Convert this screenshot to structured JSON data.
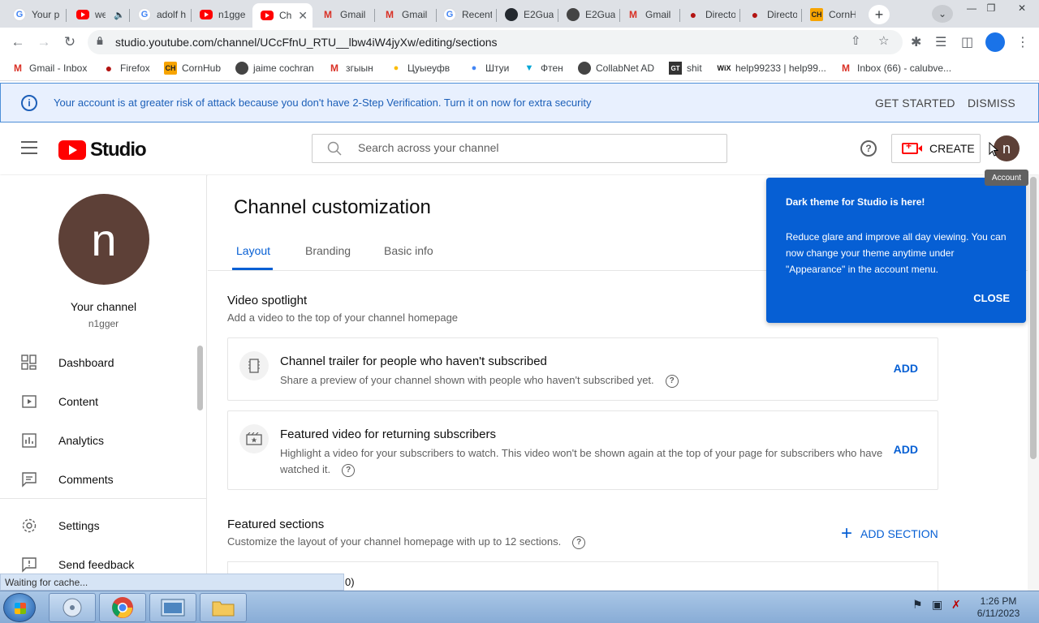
{
  "browser": {
    "tabs": [
      {
        "title": "Your p",
        "favicon": "google-icon"
      },
      {
        "title": "we",
        "favicon": "youtube-icon"
      },
      {
        "title": "adolf h",
        "favicon": "google-icon"
      },
      {
        "title": "n1gge",
        "favicon": "youtube-icon"
      },
      {
        "title": "Ch",
        "favicon": "youtube-icon"
      },
      {
        "title": "Gmail",
        "favicon": "gmail-icon"
      },
      {
        "title": "Gmail",
        "favicon": "gmail-icon"
      },
      {
        "title": "Recent",
        "favicon": "google-icon"
      },
      {
        "title": "E2Gua",
        "favicon": "github-icon"
      },
      {
        "title": "E2Gua",
        "favicon": "globe-icon"
      },
      {
        "title": "Gmail",
        "favicon": "gmail-icon"
      },
      {
        "title": "Directo",
        "favicon": "firefox-icon"
      },
      {
        "title": "Directo",
        "favicon": "firefox-icon"
      },
      {
        "title": "CornH",
        "favicon": "cornhub-icon"
      }
    ],
    "url": "studio.youtube.com/channel/UCcFfnU_RTU__lbw4iW4jyXw/editing/sections",
    "bookmarks": [
      "Gmail - Inbox",
      "Firefox",
      "CornHub",
      "jaime cochran",
      "згыын",
      "Цуыеуфв",
      "Штуи",
      "Фтен",
      "CollabNet AD",
      "shit",
      "help99233 | help99...",
      "Inbox (66) - calubve..."
    ]
  },
  "banner": {
    "message": "Your account is at greater risk of attack because you don't have 2-Step Verification. Turn it on now for extra security",
    "get_started": "GET STARTED",
    "dismiss": "DISMISS"
  },
  "header": {
    "logo_text": "Studio",
    "search_placeholder": "Search across your channel",
    "create_label": "CREATE",
    "avatar_letter": "n",
    "tooltip": "Account"
  },
  "sidebar": {
    "avatar_letter": "n",
    "channel_label": "Your channel",
    "channel_name": "n1gger",
    "items": [
      {
        "label": "Dashboard",
        "icon": "dashboard-icon"
      },
      {
        "label": "Content",
        "icon": "content-icon"
      },
      {
        "label": "Analytics",
        "icon": "analytics-icon"
      },
      {
        "label": "Comments",
        "icon": "comments-icon"
      },
      {
        "label": "Settings",
        "icon": "gear-icon"
      },
      {
        "label": "Send feedback",
        "icon": "feedback-icon"
      }
    ]
  },
  "main": {
    "title": "Channel customization",
    "tabs": [
      "Layout",
      "Branding",
      "Basic info"
    ],
    "active_tab": "Layout",
    "spotlight": {
      "title": "Video spotlight",
      "desc": "Add a video to the top of your channel homepage",
      "cards": [
        {
          "title": "Channel trailer for people who haven't subscribed",
          "desc": "Share a preview of your channel shown with people who haven't subscribed yet.",
          "action": "ADD"
        },
        {
          "title": "Featured video for returning subscribers",
          "desc": "Highlight a video for your subscribers to watch. This video won't be shown again at the top of your page for subscribers who have watched it.",
          "action": "ADD"
        }
      ]
    },
    "featured": {
      "title": "Featured sections",
      "desc": "Customize the layout of your channel homepage with up to 12 sections.",
      "add_section": "ADD SECTION",
      "peek_text": "0)"
    }
  },
  "popup": {
    "title": "Dark theme for Studio is here!",
    "body": "Reduce glare and improve all day viewing. You can now change your theme anytime under \"Appearance\" in the account menu.",
    "close": "CLOSE"
  },
  "status_bar": "Waiting for cache...",
  "taskbar": {
    "time": "1:26 PM",
    "date": "6/11/2023"
  },
  "colors": {
    "brand_red": "#ff0000",
    "accent_blue": "#065fd4",
    "banner_bg": "#e8f0fe",
    "avatar_brown": "#5d4037"
  }
}
